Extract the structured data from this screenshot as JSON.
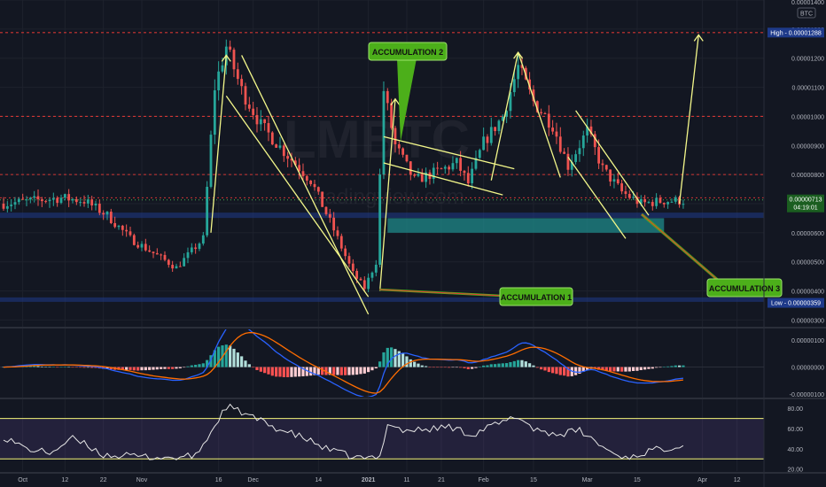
{
  "header": {
    "currency": "BTC"
  },
  "watermark": {
    "symbol": "LMBTC",
    "source": "tradingview.com"
  },
  "colors": {
    "background": "#131722",
    "grid": "#1e222d",
    "axis_text": "#b2b5be",
    "candle_up": "#26a69a",
    "candle_down": "#ef5350",
    "annotation_line": "#f3f78a",
    "resistance": "#e53935",
    "support": "#1e3a8a",
    "zone": "#1f8a8a",
    "label_green": "#4caf1a",
    "label_text": "#111111",
    "macd_line": "#2962ff",
    "signal_line": "#ff6d00",
    "rsi_line": "#e6e6e6",
    "rsi_band": "#7e57c2",
    "rsi_bound": "#f5f57a",
    "price_badge": "#1b5e20",
    "marker_badge": "#1e3a8a"
  },
  "markers": {
    "high": {
      "label": "High",
      "value": "0.00001288"
    },
    "low": {
      "label": "Low",
      "value": "0.00000359"
    },
    "current": {
      "value": "0.00000713",
      "countdown": "04:19:01"
    }
  },
  "annotations": {
    "acc1": "ACCUMULATION 1",
    "acc2": "ACCUMULATION 2",
    "acc3": "ACCUMULATION 3"
  },
  "chart_data": [
    {
      "type": "candlestick",
      "pair": "LMBTC",
      "ylim": [
        2.8e-06,
        1.4e-05
      ],
      "y_ticks": [
        "0.00000300",
        "0.00000400",
        "0.00000500",
        "0.00000600",
        "0.00000700",
        "0.00000800",
        "0.00000900",
        "0.00001000",
        "0.00001100",
        "0.00001200",
        "0.00001300",
        "0.00001400"
      ],
      "x_ticks": [
        "Oct",
        "12",
        "22",
        "Nov",
        "16",
        "Dec",
        "14",
        "2021",
        "11",
        "21",
        "Feb",
        "15",
        "Mar",
        "15",
        "Apr",
        "12"
      ],
      "horizontal_levels": [
        1.288e-05,
        1e-05,
        8e-06,
        7.2e-06,
        6.6e-06,
        3.7e-06
      ],
      "anchors": [
        [
          0,
          7e-06
        ],
        [
          15,
          7.2e-06
        ],
        [
          21,
          7.1e-06
        ],
        [
          27,
          6.6e-06
        ],
        [
          33,
          5.8e-06
        ],
        [
          39,
          5.3e-06
        ],
        [
          45,
          4.8e-06
        ],
        [
          52,
          5.8e-06
        ],
        [
          55,
          1.1e-05
        ],
        [
          58,
          1.24e-05
        ],
        [
          62,
          1.09e-05
        ],
        [
          67,
          9.7e-06
        ],
        [
          73,
          8.8e-06
        ],
        [
          80,
          7.8e-06
        ],
        [
          86,
          6.1e-06
        ],
        [
          91,
          4.6e-06
        ],
        [
          94,
          4.1e-06
        ],
        [
          97,
          5e-06
        ],
        [
          99,
          1.09e-05
        ],
        [
          102,
          9e-06
        ],
        [
          107,
          7.8e-06
        ],
        [
          113,
          8.1e-06
        ],
        [
          118,
          8.4e-06
        ],
        [
          121,
          7.7e-06
        ],
        [
          125,
          9.1e-06
        ],
        [
          130,
          1e-05
        ],
        [
          134,
          1.17e-05
        ],
        [
          138,
          1.05e-05
        ],
        [
          143,
          9.7e-06
        ],
        [
          147,
          8.3e-06
        ],
        [
          152,
          9.5e-06
        ],
        [
          156,
          8.2e-06
        ],
        [
          161,
          7.4e-06
        ],
        [
          166,
          7e-06
        ],
        [
          172,
          7.1e-06
        ],
        [
          176,
          7.1e-06
        ]
      ]
    },
    {
      "type": "macd",
      "y_ticks": [
        "0.00000100",
        "0.00000000",
        "-0.00000100"
      ],
      "ylim": [
        -1.1e-06,
        1.4e-06
      ]
    },
    {
      "type": "rsi",
      "y_ticks": [
        "80.00",
        "60.00",
        "40.00",
        "20.00"
      ],
      "ylim": [
        18,
        88
      ],
      "upper_band": 70,
      "lower_band": 30,
      "anchors": [
        [
          0,
          52
        ],
        [
          6,
          40
        ],
        [
          12,
          36
        ],
        [
          18,
          50
        ],
        [
          22,
          43
        ],
        [
          26,
          34
        ],
        [
          32,
          33
        ],
        [
          38,
          32
        ],
        [
          44,
          31
        ],
        [
          50,
          33
        ],
        [
          54,
          56
        ],
        [
          58,
          82
        ],
        [
          62,
          76
        ],
        [
          66,
          69
        ],
        [
          72,
          59
        ],
        [
          78,
          51
        ],
        [
          84,
          40
        ],
        [
          90,
          33
        ],
        [
          94,
          30
        ],
        [
          98,
          32
        ],
        [
          100,
          66
        ],
        [
          104,
          58
        ],
        [
          110,
          59
        ],
        [
          116,
          62
        ],
        [
          122,
          54
        ],
        [
          126,
          61
        ],
        [
          130,
          66
        ],
        [
          134,
          72
        ],
        [
          138,
          60
        ],
        [
          144,
          54
        ],
        [
          150,
          58
        ],
        [
          156,
          42
        ],
        [
          160,
          33
        ],
        [
          164,
          32
        ],
        [
          168,
          38
        ],
        [
          172,
          40
        ],
        [
          176,
          44
        ]
      ]
    }
  ]
}
